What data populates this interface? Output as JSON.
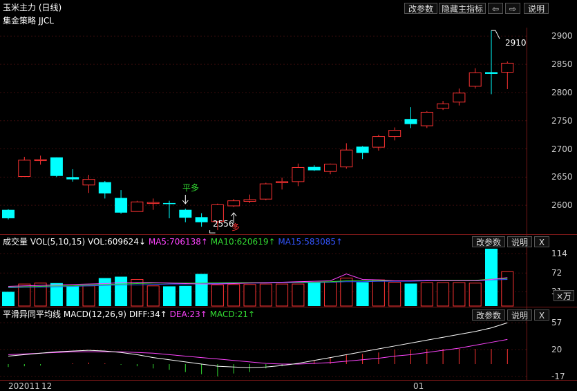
{
  "header": {
    "title": "玉米主力 (日线)",
    "strategy": "集金策略 JJCL",
    "buttons": {
      "params": "改参数",
      "hide_indicator": "隐藏主指标",
      "prev": "⇦",
      "next": "⇨",
      "help": "说明"
    }
  },
  "main_chart": {
    "price_axis": [
      "2900",
      "2850",
      "2800",
      "2750",
      "2700",
      "2650",
      "2600"
    ],
    "annotations": {
      "high_value": "2910",
      "low_value": "2556",
      "signal_flat": "平多",
      "signal_long": "多"
    }
  },
  "volume_panel": {
    "title": "成交量",
    "vol_name": "VOL(5,10,15)",
    "vol_value": "VOL:609624↓",
    "ma5": "MA5:706138↑",
    "ma10": "MA10:620619↑",
    "ma15": "MA15:583085↑",
    "axis": [
      "114",
      "72",
      "31"
    ],
    "unit": "×万",
    "buttons": {
      "params": "改参数",
      "help": "说明",
      "close": "X"
    }
  },
  "macd_panel": {
    "title": "平滑异同平均线",
    "macd_name": "MACD(12,26,9)",
    "diff": "DIFF:34↑",
    "dea": "DEA:23↑",
    "macd": "MACD:21↑",
    "axis": [
      "57",
      "20",
      "-17"
    ],
    "buttons": {
      "params": "改参数",
      "help": "说明",
      "close": "X"
    }
  },
  "time_axis": {
    "start": "202011",
    "month1": "12",
    "month2": "01"
  },
  "colors": {
    "up": "#ff3333",
    "down": "#00ffff",
    "ma5": "#ff44ff",
    "ma10": "#33dd33",
    "ma15": "#3355ff"
  },
  "chart_data": {
    "type": "candlestick",
    "title": "玉米主力 (日线)",
    "ylim": [
      2550,
      2915
    ],
    "candles": [
      {
        "o": 2592,
        "c": 2577,
        "h": 2593,
        "l": 2575
      },
      {
        "o": 2651,
        "c": 2680,
        "h": 2686,
        "l": 2651
      },
      {
        "o": 2680,
        "c": 2681,
        "h": 2688,
        "l": 2672
      },
      {
        "o": 2685,
        "c": 2652,
        "h": 2685,
        "l": 2650
      },
      {
        "o": 2650,
        "c": 2646,
        "h": 2664,
        "l": 2642
      },
      {
        "o": 2636,
        "c": 2646,
        "h": 2654,
        "l": 2622
      },
      {
        "o": 2641,
        "c": 2621,
        "h": 2643,
        "l": 2612
      },
      {
        "o": 2613,
        "c": 2587,
        "h": 2627,
        "l": 2585
      },
      {
        "o": 2589,
        "c": 2606,
        "h": 2608,
        "l": 2589
      },
      {
        "o": 2604,
        "c": 2605,
        "h": 2612,
        "l": 2592
      },
      {
        "o": 2604,
        "c": 2603,
        "h": 2608,
        "l": 2577
      },
      {
        "o": 2592,
        "c": 2578,
        "h": 2594,
        "l": 2570
      },
      {
        "o": 2579,
        "c": 2570,
        "h": 2586,
        "l": 2562
      },
      {
        "o": 2571,
        "c": 2601,
        "h": 2603,
        "l": 2556
      },
      {
        "o": 2599,
        "c": 2608,
        "h": 2611,
        "l": 2597
      },
      {
        "o": 2607,
        "c": 2610,
        "h": 2619,
        "l": 2604
      },
      {
        "o": 2611,
        "c": 2638,
        "h": 2640,
        "l": 2609
      },
      {
        "o": 2640,
        "c": 2642,
        "h": 2649,
        "l": 2628
      },
      {
        "o": 2642,
        "c": 2667,
        "h": 2674,
        "l": 2634
      },
      {
        "o": 2668,
        "c": 2662,
        "h": 2671,
        "l": 2661
      },
      {
        "o": 2660,
        "c": 2673,
        "h": 2674,
        "l": 2655
      },
      {
        "o": 2668,
        "c": 2698,
        "h": 2710,
        "l": 2665
      },
      {
        "o": 2704,
        "c": 2693,
        "h": 2705,
        "l": 2682
      },
      {
        "o": 2703,
        "c": 2722,
        "h": 2725,
        "l": 2697
      },
      {
        "o": 2722,
        "c": 2733,
        "h": 2738,
        "l": 2715
      },
      {
        "o": 2753,
        "c": 2744,
        "h": 2774,
        "l": 2737
      },
      {
        "o": 2741,
        "c": 2765,
        "h": 2767,
        "l": 2737
      },
      {
        "o": 2772,
        "c": 2780,
        "h": 2785,
        "l": 2769
      },
      {
        "o": 2783,
        "c": 2799,
        "h": 2807,
        "l": 2777
      },
      {
        "o": 2811,
        "c": 2835,
        "h": 2843,
        "l": 2807
      },
      {
        "o": 2836,
        "c": 2833,
        "h": 2910,
        "l": 2797
      },
      {
        "o": 2836,
        "c": 2852,
        "h": 2855,
        "l": 2806
      }
    ],
    "volume": {
      "ylim": [
        0,
        125
      ],
      "values": [
        31,
        48,
        50,
        50,
        44,
        44,
        61,
        64,
        58,
        44,
        43,
        44,
        70,
        46,
        47,
        47,
        48,
        48,
        48,
        51,
        52,
        61,
        52,
        57,
        52,
        49,
        51,
        51,
        51,
        50,
        125,
        75
      ],
      "ma5": [
        43,
        44,
        45,
        46,
        47,
        48,
        49,
        51,
        52,
        51,
        50,
        49,
        48,
        48,
        49,
        50,
        51,
        52,
        53,
        54,
        55,
        70,
        58,
        57,
        55,
        55,
        56,
        55,
        55,
        55,
        58,
        62
      ],
      "ma10": [
        41,
        42,
        43,
        44,
        44,
        46,
        47,
        48,
        49,
        50,
        50,
        50,
        50,
        51,
        51,
        51,
        51,
        52,
        52,
        52,
        53,
        55,
        55,
        55,
        55,
        55,
        56,
        56,
        56,
        56,
        59,
        60
      ],
      "ma15": [
        40,
        41,
        41,
        42,
        43,
        44,
        45,
        46,
        46,
        47,
        48,
        48,
        49,
        49,
        50,
        50,
        50,
        51,
        51,
        51,
        52,
        53,
        53,
        54,
        54,
        54,
        55,
        55,
        55,
        55,
        57,
        58
      ]
    },
    "macd": {
      "ylim": [
        -20,
        62
      ],
      "diff": [
        11,
        13,
        15,
        17,
        18,
        19,
        18,
        16,
        13,
        9,
        6,
        3,
        0,
        -3,
        -4,
        -5,
        -4,
        -2,
        1,
        5,
        9,
        13,
        17,
        21,
        25,
        29,
        33,
        37,
        41,
        45,
        50,
        57
      ],
      "dea": [
        13,
        14,
        15,
        16,
        17,
        17,
        17,
        17,
        16,
        15,
        13,
        11,
        9,
        7,
        5,
        3,
        1,
        0,
        0,
        1,
        2,
        4,
        6,
        8,
        11,
        13,
        16,
        19,
        22,
        26,
        30,
        34
      ],
      "hist": [
        -4,
        -3,
        -2,
        0,
        1,
        2,
        1,
        -1,
        -3,
        -6,
        -8,
        -11,
        -14,
        -17,
        -13,
        -11,
        -6,
        -3,
        1,
        5,
        9,
        13,
        14,
        16,
        20,
        20,
        21,
        21,
        21,
        21,
        21,
        21
      ]
    }
  }
}
